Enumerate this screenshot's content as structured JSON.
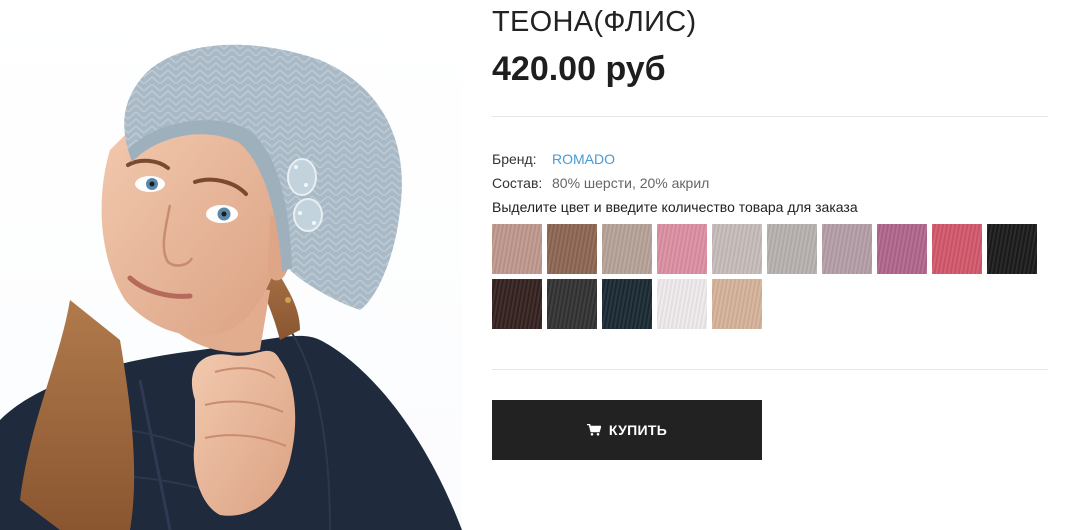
{
  "product": {
    "title": "ТЕОНА(ФЛИС)",
    "price": "420.00 руб",
    "brand_label": "Бренд:",
    "brand_value": "ROMADO",
    "composition_label": "Состав:",
    "composition_value": "80% шерсти, 20% акрил",
    "color_hint": "Выделите цвет и введите количество товара для заказа",
    "buy_label": "КУПИТЬ"
  },
  "swatches": [
    {
      "color": "#c0988d"
    },
    {
      "color": "#8d6654"
    },
    {
      "color": "#b6a398"
    },
    {
      "color": "#dc8fa2"
    },
    {
      "color": "#c6bcba"
    },
    {
      "color": "#b7b2b0"
    },
    {
      "color": "#b59ea8"
    },
    {
      "color": "#b0668c"
    },
    {
      "color": "#d2596c"
    },
    {
      "color": "#1b1b1b"
    },
    {
      "color": "#34221f"
    },
    {
      "color": "#323232"
    },
    {
      "color": "#1a2a33"
    },
    {
      "color": "#efeaec"
    },
    {
      "color": "#d6b39b"
    }
  ],
  "icons": {
    "cart": "shopping-cart-icon"
  }
}
